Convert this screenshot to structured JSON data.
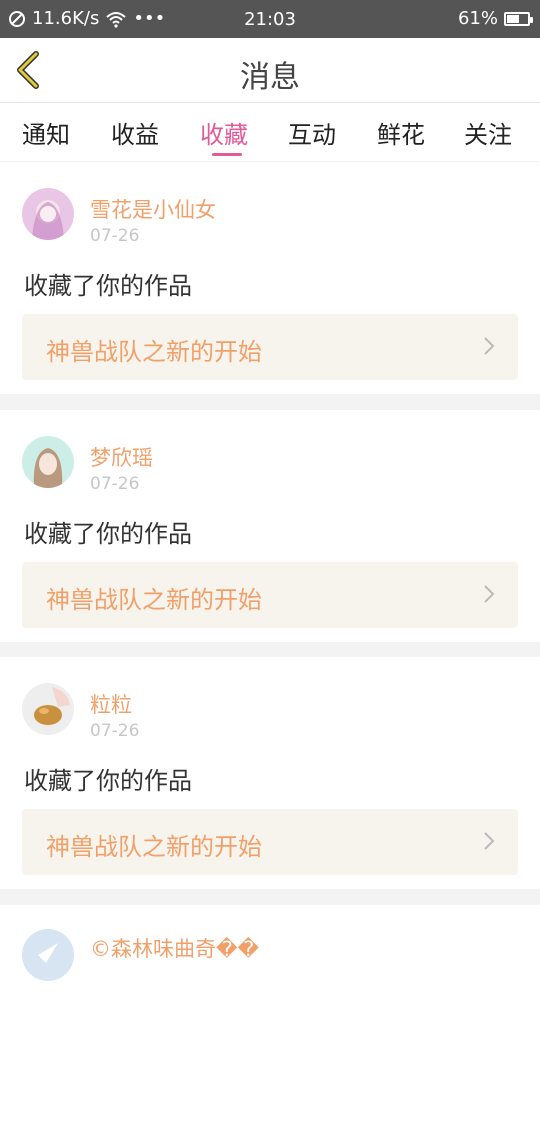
{
  "status": {
    "speed": "11.6K/s",
    "time": "21:03",
    "battery_text": "61%",
    "battery_level": 0.61
  },
  "header": {
    "title": "消息"
  },
  "tabs": [
    {
      "label": "通知"
    },
    {
      "label": "收益"
    },
    {
      "label": "收藏"
    },
    {
      "label": "互动"
    },
    {
      "label": "鲜花"
    },
    {
      "label": "关注"
    }
  ],
  "active_tab_index": 2,
  "colors": {
    "accent": "#e15b99",
    "name": "#f2a06a",
    "work_bg": "#f6f4ec"
  },
  "messages": [
    {
      "user": "雪花是小仙女",
      "date": "07-26",
      "action": "收藏了你的作品",
      "work": "神兽战队之新的开始"
    },
    {
      "user": "梦欣瑶",
      "date": "07-26",
      "action": "收藏了你的作品",
      "work": "神兽战队之新的开始"
    },
    {
      "user": "粒粒",
      "date": "07-26",
      "action": "收藏了你的作品",
      "work": "神兽战队之新的开始"
    },
    {
      "user": "©森林味曲奇��",
      "date": "",
      "action": "",
      "work": ""
    }
  ]
}
